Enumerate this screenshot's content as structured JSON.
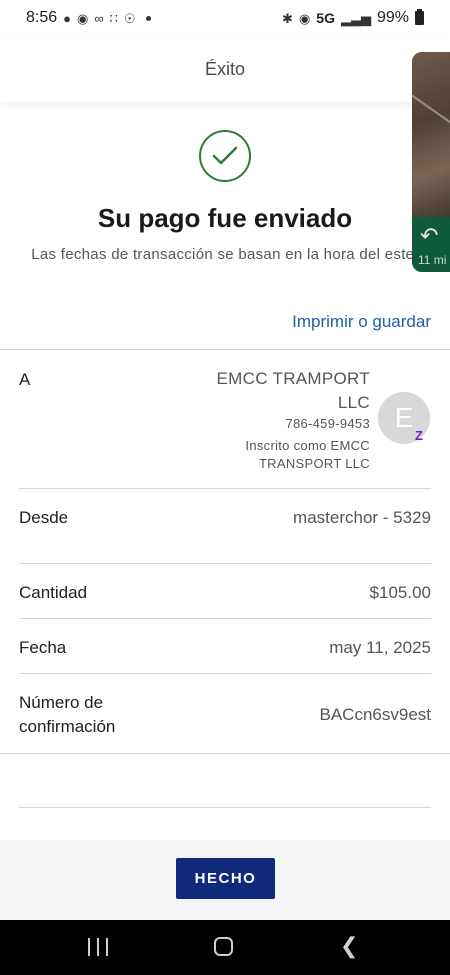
{
  "status_bar": {
    "time": "8:56",
    "network": "5G",
    "battery": "99%"
  },
  "header": {
    "title": "Éxito"
  },
  "navigation_widget": {
    "distance": "11 mi"
  },
  "success": {
    "title": "Su pago fue enviado",
    "subtitle": "Las fechas de transacción se basan en la hora del este."
  },
  "print_link": "Imprimir o guardar",
  "recipient": {
    "label": "A",
    "name": "EMCC TRAMPORT LLC",
    "phone": "786-459-9453",
    "registered_as": "Inscrito como EMCC TRANSPORT LLC",
    "avatar_initial": "E",
    "badge": "Z"
  },
  "rows": [
    {
      "label": "Desde",
      "value": "masterchor - 5329"
    },
    {
      "label": "Cantidad",
      "value": "$105.00"
    },
    {
      "label": "Fecha",
      "value": "may 11, 2025"
    },
    {
      "label": "Número de confirmación",
      "value": "BACcn6sv9est"
    }
  ],
  "done_button": "HECHO",
  "colors": {
    "link": "#1f5fa6",
    "success_green": "#2e7d32",
    "button_navy": "#0f2a7a",
    "zelle_purple": "#6d1ed4"
  }
}
